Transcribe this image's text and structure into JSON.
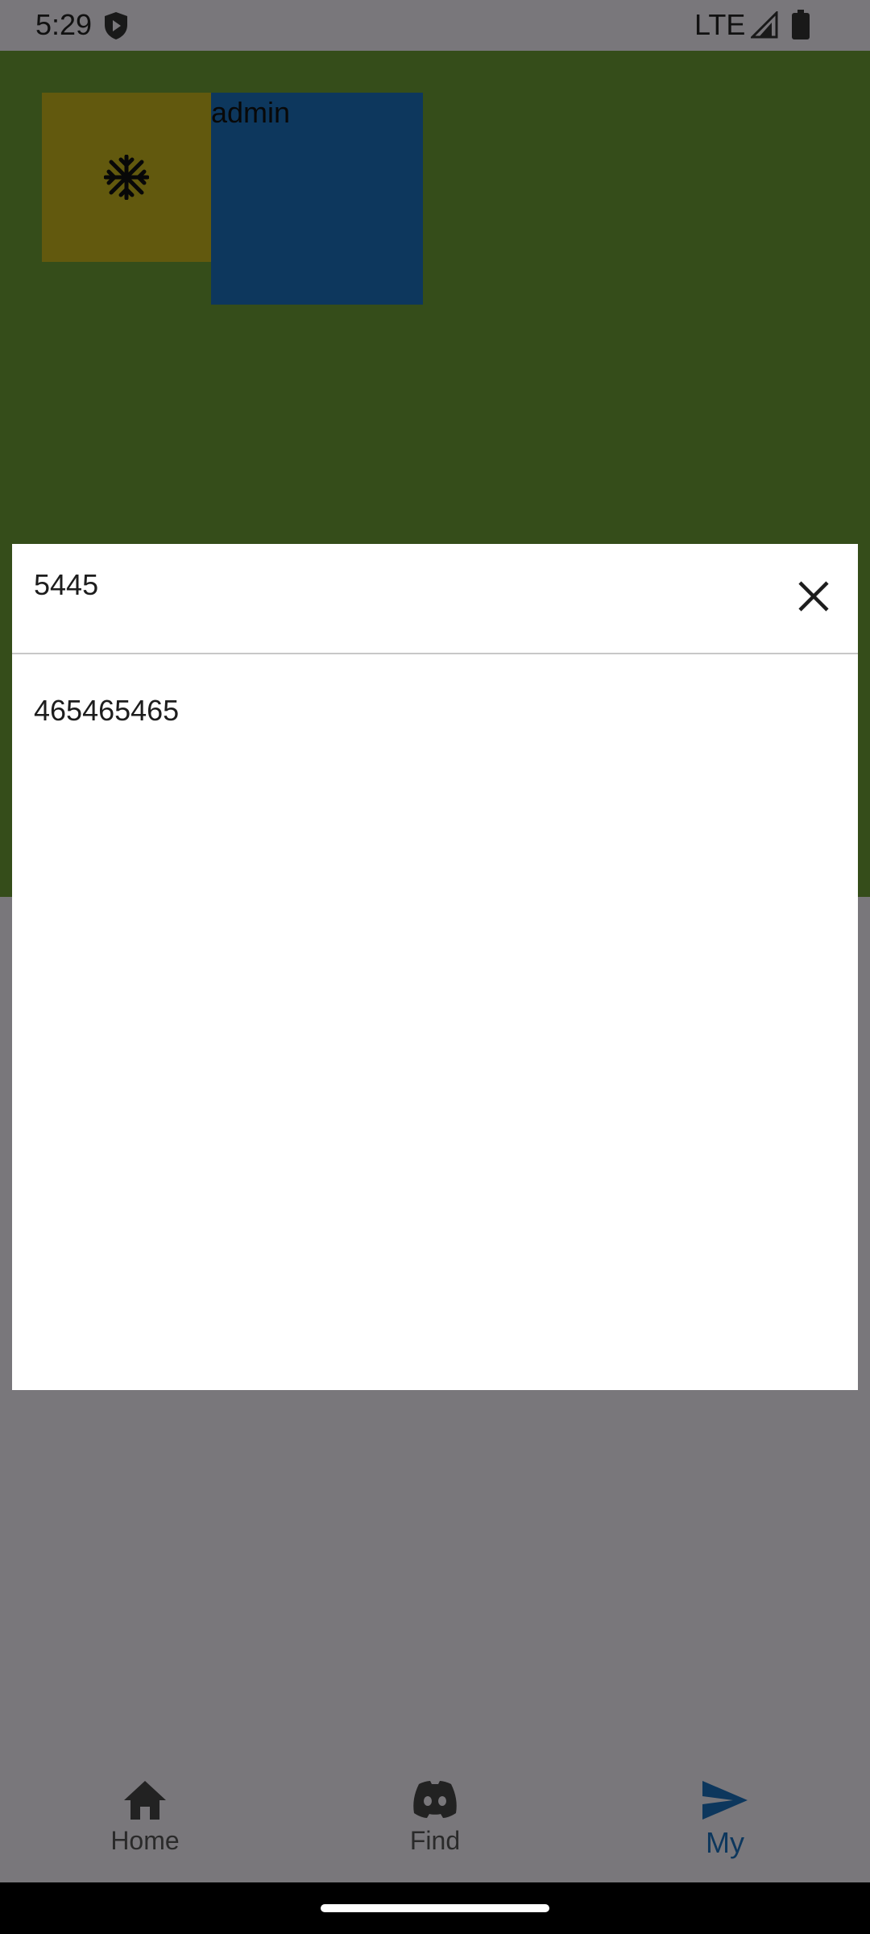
{
  "status_bar": {
    "time": "5:29",
    "network": "LTE"
  },
  "profile": {
    "avatar_icon": "snowflake-icon",
    "username": "admin",
    "colors": {
      "panel": "#6b9a34",
      "icon_box": "#c4b21c",
      "info_box": "#1a6fba"
    }
  },
  "dialog": {
    "title": "5445",
    "body": "465465465",
    "close_icon": "close-icon"
  },
  "bottom_nav": {
    "items": [
      {
        "label": "Home",
        "icon": "home-icon",
        "active": false
      },
      {
        "label": "Find",
        "icon": "discord-icon",
        "active": false
      },
      {
        "label": "My",
        "icon": "send-icon",
        "active": true
      }
    ],
    "active_color": "#1a6fba"
  }
}
